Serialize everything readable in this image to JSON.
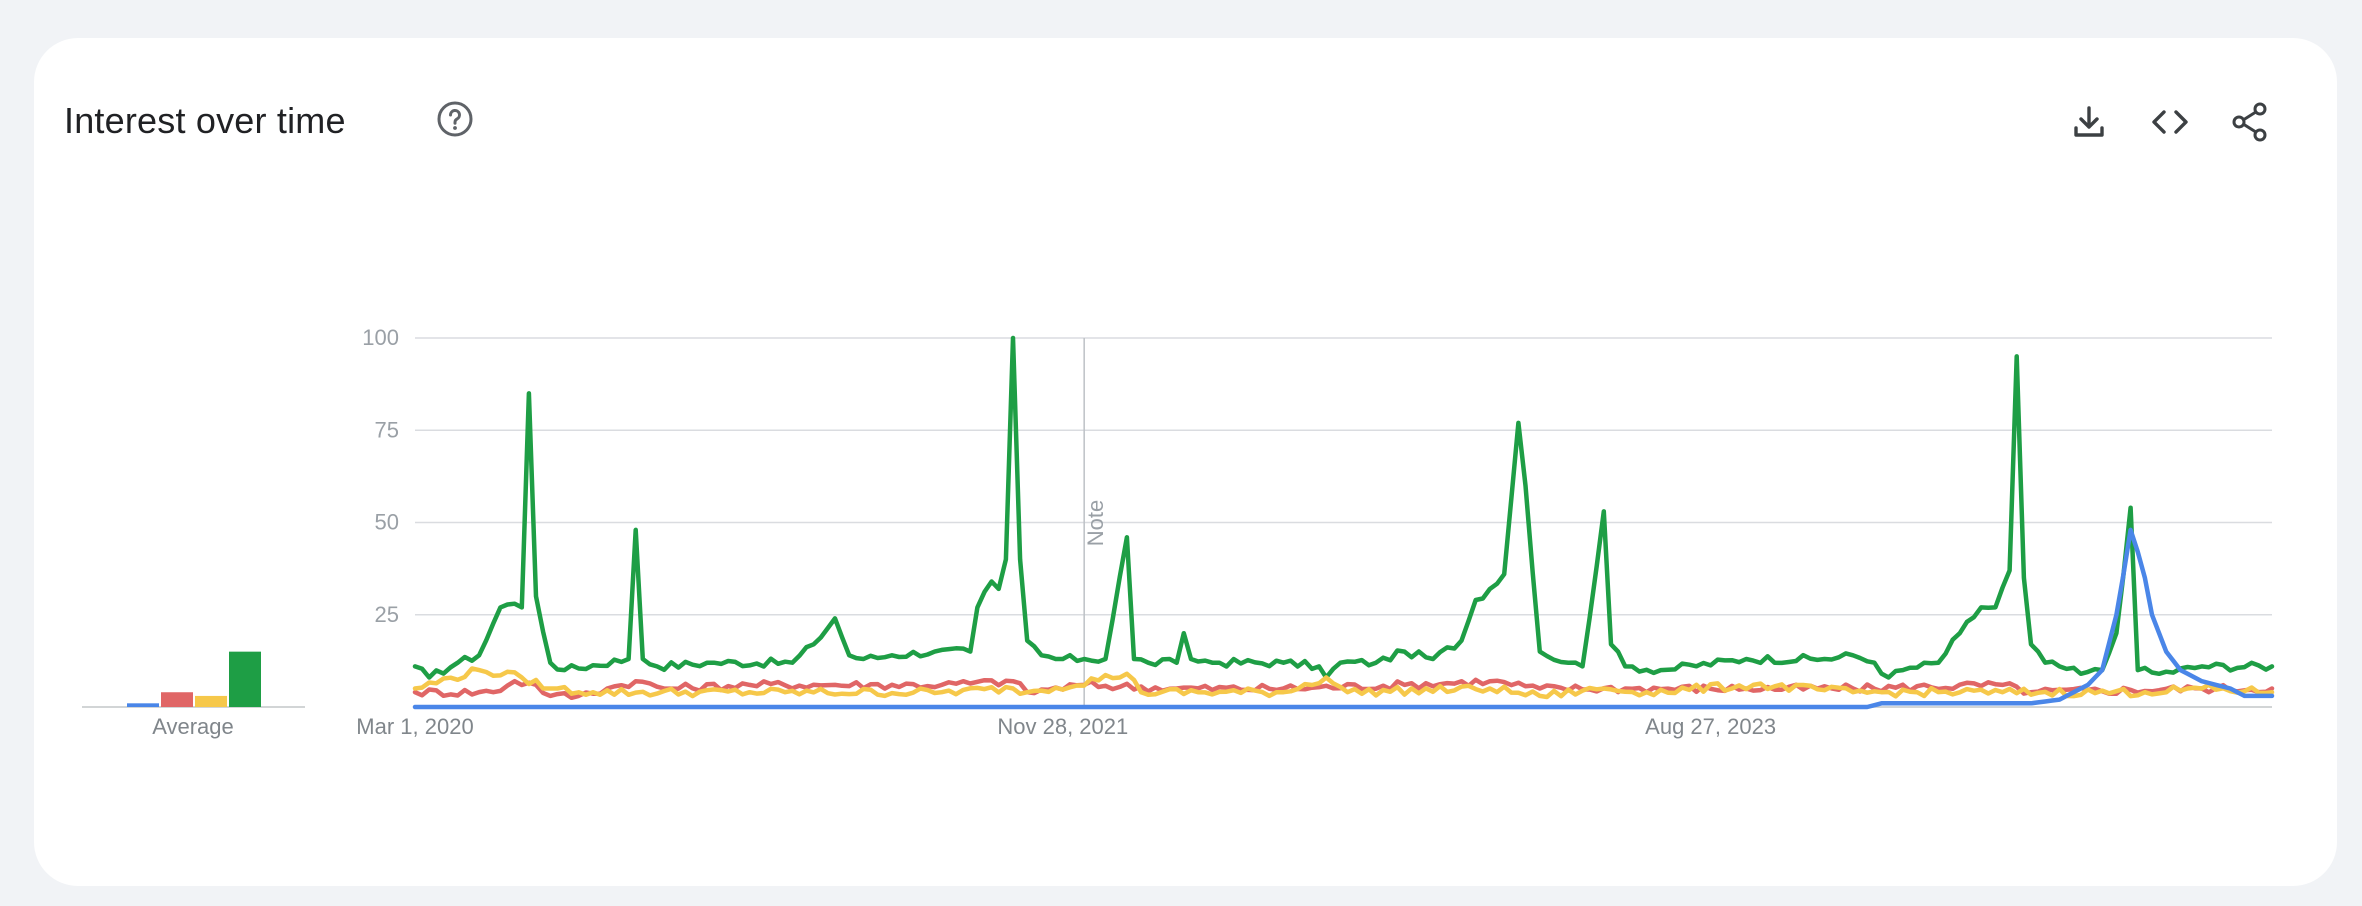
{
  "header": {
    "title": "Interest over time",
    "icons": {
      "help": "help-circle-icon",
      "download": "download-icon",
      "embed": "embed-code-icon",
      "share": "share-icon"
    }
  },
  "colors": {
    "blue": "#4a86e8",
    "red": "#e06666",
    "yellow": "#f6c84a",
    "green": "#1e9e45",
    "grid": "#dadce0",
    "axis_text": "#80868b"
  },
  "chart_data": [
    {
      "type": "bar",
      "categories": [
        "",
        "",
        "",
        ""
      ],
      "values": [
        1,
        4,
        3,
        15
      ],
      "colors": [
        "#4a86e8",
        "#e06666",
        "#f6c84a",
        "#1e9e45"
      ],
      "xlabel": "Average",
      "ylim": [
        0,
        100
      ]
    },
    {
      "type": "line",
      "x_range": [
        "Mar 1, 2020",
        "2025-03-01"
      ],
      "x_ticks": [
        {
          "date": "2020-03-01",
          "label": "Mar 1, 2020"
        },
        {
          "date": "2021-11-28",
          "label": "Nov 28, 2021"
        },
        {
          "date": "2023-08-27",
          "label": "Aug 27, 2023"
        }
      ],
      "y_ticks": [
        25,
        50,
        75,
        100
      ],
      "ylim": [
        0,
        100
      ],
      "grid": true,
      "annotations": [
        {
          "date": "2021-12-19",
          "label": "Note"
        }
      ],
      "series": [
        {
          "color": "#1e9e45",
          "baseline": 12,
          "keypoints": [
            [
              "2020-03-01",
              11
            ],
            [
              "2020-03-15",
              8
            ],
            [
              "2020-04-12",
              12
            ],
            [
              "2020-05-03",
              14
            ],
            [
              "2020-05-24",
              27
            ],
            [
              "2020-06-07",
              28
            ],
            [
              "2020-06-14",
              27
            ],
            [
              "2020-06-21",
              85
            ],
            [
              "2020-06-28",
              30
            ],
            [
              "2020-07-12",
              12
            ],
            [
              "2020-07-26",
              10
            ],
            [
              "2020-09-27",
              13
            ],
            [
              "2020-10-04",
              48
            ],
            [
              "2020-10-11",
              13
            ],
            [
              "2020-10-25",
              11
            ],
            [
              "2020-12-20",
              12
            ],
            [
              "2021-03-07",
              12
            ],
            [
              "2021-03-28",
              17
            ],
            [
              "2021-04-18",
              24
            ],
            [
              "2021-05-02",
              14
            ],
            [
              "2021-05-16",
              13
            ],
            [
              "2021-06-13",
              14
            ],
            [
              "2021-07-25",
              15
            ],
            [
              "2021-08-29",
              15
            ],
            [
              "2021-09-05",
              27
            ],
            [
              "2021-09-19",
              34
            ],
            [
              "2021-09-26",
              32
            ],
            [
              "2021-10-03",
              40
            ],
            [
              "2021-10-10",
              100
            ],
            [
              "2021-10-17",
              40
            ],
            [
              "2021-10-24",
              18
            ],
            [
              "2021-11-07",
              14
            ],
            [
              "2021-11-21",
              13
            ],
            [
              "2021-12-19",
              13
            ],
            [
              "2022-01-09",
              13
            ],
            [
              "2022-01-30",
              46
            ],
            [
              "2022-02-06",
              13
            ],
            [
              "2022-02-20",
              12
            ],
            [
              "2022-03-20",
              12
            ],
            [
              "2022-03-27",
              20
            ],
            [
              "2022-04-03",
              13
            ],
            [
              "2022-05-01",
              12
            ],
            [
              "2022-07-03",
              12
            ],
            [
              "2022-08-07",
              11
            ],
            [
              "2022-08-14",
              8
            ],
            [
              "2022-08-28",
              12
            ],
            [
              "2022-10-02",
              12
            ],
            [
              "2022-10-30",
              15
            ],
            [
              "2022-11-27",
              13
            ],
            [
              "2022-12-25",
              18
            ],
            [
              "2023-01-08",
              29
            ],
            [
              "2023-01-22",
              32
            ],
            [
              "2023-02-05",
              36
            ],
            [
              "2023-02-19",
              77
            ],
            [
              "2023-02-26",
              60
            ],
            [
              "2023-03-12",
              15
            ],
            [
              "2023-04-09",
              12
            ],
            [
              "2023-04-23",
              11
            ],
            [
              "2023-05-14",
              53
            ],
            [
              "2023-05-21",
              17
            ],
            [
              "2023-06-04",
              11
            ],
            [
              "2023-07-09",
              10
            ],
            [
              "2023-10-01",
              13
            ],
            [
              "2023-12-17",
              13
            ],
            [
              "2024-01-14",
              14
            ],
            [
              "2024-02-04",
              12
            ],
            [
              "2024-02-18",
              8
            ],
            [
              "2024-03-03",
              10
            ],
            [
              "2024-04-07",
              12
            ],
            [
              "2024-04-28",
              20
            ],
            [
              "2024-05-19",
              27
            ],
            [
              "2024-06-02",
              27
            ],
            [
              "2024-06-16",
              37
            ],
            [
              "2024-06-23",
              95
            ],
            [
              "2024-06-30",
              35
            ],
            [
              "2024-07-07",
              17
            ],
            [
              "2024-07-21",
              12
            ],
            [
              "2024-08-04",
              11
            ],
            [
              "2024-08-25",
              9
            ],
            [
              "2024-09-15",
              10
            ],
            [
              "2024-09-29",
              20
            ],
            [
              "2024-10-13",
              54
            ],
            [
              "2024-10-20",
              10
            ],
            [
              "2024-11-10",
              9
            ],
            [
              "2024-12-22",
              11
            ],
            [
              "2025-03-01",
              11
            ]
          ]
        },
        {
          "color": "#e06666",
          "baseline": 5,
          "keypoints": [
            [
              "2020-03-01",
              4
            ],
            [
              "2020-05-17",
              4
            ],
            [
              "2020-06-07",
              7
            ],
            [
              "2020-06-28",
              6
            ],
            [
              "2020-07-12",
              3
            ],
            [
              "2020-08-09",
              3
            ],
            [
              "2020-09-06",
              5
            ],
            [
              "2020-10-04",
              7
            ],
            [
              "2020-11-01",
              5
            ],
            [
              "2021-01-24",
              6
            ],
            [
              "2021-04-18",
              6
            ],
            [
              "2021-08-01",
              6
            ],
            [
              "2021-10-10",
              7
            ],
            [
              "2021-10-24",
              4
            ],
            [
              "2021-12-19",
              6
            ],
            [
              "2022-03-20",
              5
            ],
            [
              "2022-07-03",
              5
            ],
            [
              "2022-10-30",
              6
            ],
            [
              "2023-01-22",
              7
            ],
            [
              "2023-03-12",
              5
            ],
            [
              "2023-06-04",
              5
            ],
            [
              "2023-10-01",
              5
            ],
            [
              "2024-01-14",
              5
            ],
            [
              "2024-06-09",
              6
            ],
            [
              "2024-07-07",
              4
            ],
            [
              "2024-12-22",
              5
            ],
            [
              "2025-03-01",
              5
            ]
          ]
        },
        {
          "color": "#f6c84a",
          "baseline": 4,
          "keypoints": [
            [
              "2020-03-01",
              5
            ],
            [
              "2020-05-03",
              10
            ],
            [
              "2020-06-14",
              8
            ],
            [
              "2020-07-12",
              5
            ],
            [
              "2020-08-23",
              4
            ],
            [
              "2021-02-28",
              4
            ],
            [
              "2021-08-01",
              4
            ],
            [
              "2021-10-10",
              5
            ],
            [
              "2021-10-24",
              4
            ],
            [
              "2022-01-30",
              9
            ],
            [
              "2022-02-13",
              4
            ],
            [
              "2022-07-03",
              4
            ],
            [
              "2022-08-14",
              8
            ],
            [
              "2022-09-04",
              4
            ],
            [
              "2023-01-22",
              5
            ],
            [
              "2023-03-12",
              3
            ],
            [
              "2023-05-14",
              5
            ],
            [
              "2023-06-25",
              4
            ],
            [
              "2023-10-08",
              6
            ],
            [
              "2024-01-14",
              4
            ],
            [
              "2024-06-09",
              4
            ],
            [
              "2024-10-27",
              4
            ],
            [
              "2024-12-22",
              5
            ],
            [
              "2025-03-01",
              4
            ]
          ]
        },
        {
          "color": "#4a86e8",
          "baseline": 0,
          "keypoints": [
            [
              "2020-03-01",
              0
            ],
            [
              "2024-01-28",
              0
            ],
            [
              "2024-02-11",
              1
            ],
            [
              "2024-05-19",
              1
            ],
            [
              "2024-07-07",
              1
            ],
            [
              "2024-08-04",
              2
            ],
            [
              "2024-09-01",
              6
            ],
            [
              "2024-09-15",
              10
            ],
            [
              "2024-09-29",
              25
            ],
            [
              "2024-10-06",
              36
            ],
            [
              "2024-10-13",
              48
            ],
            [
              "2024-10-20",
              42
            ],
            [
              "2024-10-27",
              35
            ],
            [
              "2024-11-03",
              25
            ],
            [
              "2024-11-17",
              15
            ],
            [
              "2024-12-01",
              10
            ],
            [
              "2024-12-22",
              7
            ],
            [
              "2025-01-19",
              5
            ],
            [
              "2025-02-02",
              3
            ],
            [
              "2025-03-01",
              3
            ]
          ]
        }
      ]
    }
  ]
}
